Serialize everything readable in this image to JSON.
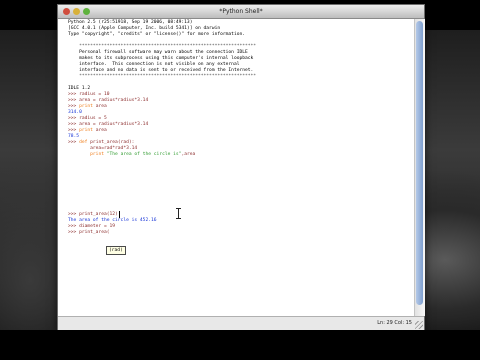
{
  "window": {
    "title": "*Python Shell*"
  },
  "shell": {
    "banner": [
      "Python 2.5 (r25:51918, Sep 19 2006, 08:49:13)",
      "[GCC 4.0.1 (Apple Computer, Inc. build 5341)] on darwin",
      "Type \"copyright\", \"credits\" or \"license()\" for more information."
    ],
    "firewall_notice": [
      "    ****************************************************************",
      "    Personal firewall software may warn about the connection IDLE",
      "    makes to its subprocess using this computer's internal loopback",
      "    interface.  This connection is not visible on any external",
      "    interface and no data is sent to or received from the Internet.",
      "    ****************************************************************"
    ],
    "idle_version": "IDLE 1.2",
    "session": {
      "l1": ">>> radius = 10",
      "l2": ">>> area = radius*radius*3.14",
      "l3_prompt": ">>> ",
      "l3_kw": "print",
      "l3_rest": " area",
      "o1": "314.0",
      "l4": ">>> radius = 5",
      "l5": ">>> area = radius*radius*3.14",
      "l6_prompt": ">>> ",
      "l6_kw": "print",
      "l6_rest": " area",
      "o2": "78.5",
      "d1_prompt": ">>> ",
      "d1_kw": "def",
      "d1_rest": " print_area(rad):",
      "d2": "        area=rad*rad*3.14",
      "d3_indent": "        ",
      "d3_kw": "print",
      "d3_str": " \"The area of the circle is\"",
      "d3_rest": ",area",
      "c1": ">>> print_area(12)",
      "o3": "The area of the circle is 452.16",
      "c2": ">>> diameter = 19",
      "c3": ">>> print_area("
    },
    "calltip": "(rad)"
  },
  "status": {
    "position": "Ln: 29 Col: 15"
  },
  "icons": [
    "close-icon",
    "minimize-icon",
    "zoom-icon",
    "resize-grip-icon",
    "ibeam-cursor-icon"
  ]
}
